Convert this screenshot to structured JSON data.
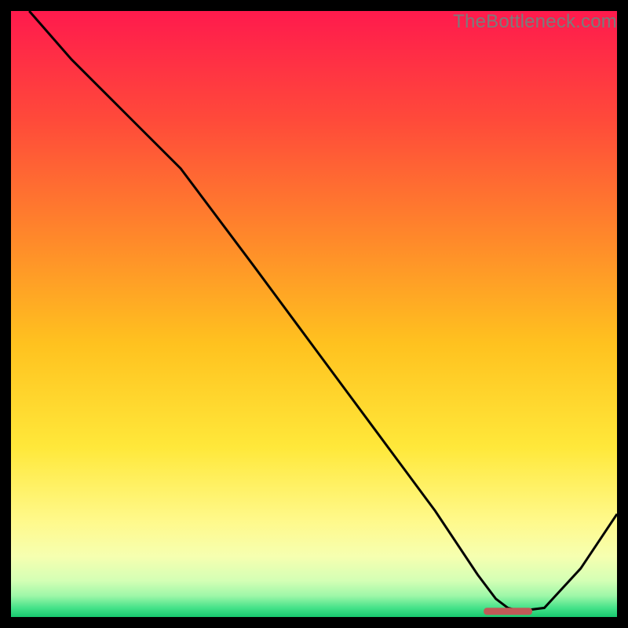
{
  "watermark": {
    "text": "TheBottleneck.com"
  },
  "chart_data": {
    "type": "line",
    "title": "",
    "xlabel": "",
    "ylabel": "",
    "xlim": [
      0,
      100
    ],
    "ylim": [
      0,
      100
    ],
    "series": [
      {
        "name": "curve",
        "x": [
          3,
          10,
          20,
          28,
          40,
          50,
          60,
          70,
          77,
          80,
          82,
          84,
          88,
          94,
          100
        ],
        "values": [
          100,
          92,
          82,
          74,
          58,
          44.5,
          31,
          17.5,
          7,
          3,
          1.5,
          1,
          1.5,
          8,
          17
        ]
      }
    ],
    "marker": {
      "x_start": 78,
      "x_end": 86,
      "y": 1
    },
    "gradient_stops": [
      {
        "offset": 0,
        "color": "#ff1a4d"
      },
      {
        "offset": 0.18,
        "color": "#ff4a3a"
      },
      {
        "offset": 0.38,
        "color": "#ff8a2a"
      },
      {
        "offset": 0.55,
        "color": "#ffc21f"
      },
      {
        "offset": 0.72,
        "color": "#ffe83a"
      },
      {
        "offset": 0.84,
        "color": "#fff98a"
      },
      {
        "offset": 0.9,
        "color": "#f6ffb0"
      },
      {
        "offset": 0.94,
        "color": "#d4ffb5"
      },
      {
        "offset": 0.965,
        "color": "#9ef7a8"
      },
      {
        "offset": 0.985,
        "color": "#45e289"
      },
      {
        "offset": 1.0,
        "color": "#17c96f"
      }
    ],
    "line_color": "#000000",
    "marker_color": "#c05a57"
  }
}
